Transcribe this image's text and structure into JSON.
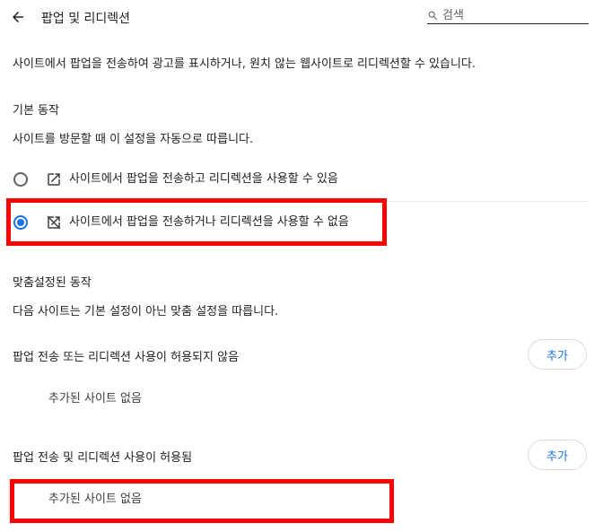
{
  "header": {
    "back_icon": "arrow-back-icon",
    "title": "팝업 및 리디렉션",
    "search": {
      "icon": "search-icon",
      "placeholder": "검색",
      "value": ""
    }
  },
  "description": "사이트에서 팝업을 전송하여 광고를 표시하거나, 원치 않는 웹사이트로 리디렉션할 수 있습니다.",
  "default_behavior": {
    "heading": "기본 동작",
    "subtext": "사이트를 방문할 때 이 설정을 자동으로 따릅니다.",
    "options": [
      {
        "label": "사이트에서 팝업을 전송하고 리디렉션을 사용할 수 있음",
        "icon": "open-in-new-icon",
        "selected": false
      },
      {
        "label": "사이트에서 팝업을 전송하거나 리디렉션을 사용할 수 없음",
        "icon": "popup-blocked-icon",
        "selected": true
      }
    ]
  },
  "custom_behavior": {
    "heading": "맞춤설정된 동작",
    "subtext": "다음 사이트는 기본 설정이 아닌 맞춤 설정을 따릅니다.",
    "sections": [
      {
        "title": "팝업 전송 또는 리디렉션 사용이 허용되지 않음",
        "add_label": "추가",
        "empty_text": "추가된 사이트 없음"
      },
      {
        "title": "팝업 전송 및 리디렉션 사용이 허용됨",
        "add_label": "추가",
        "empty_text": "추가된 사이트 없음"
      }
    ]
  },
  "colors": {
    "accent": "#1a73e8",
    "highlight": "#ff0000",
    "text": "#202124"
  }
}
